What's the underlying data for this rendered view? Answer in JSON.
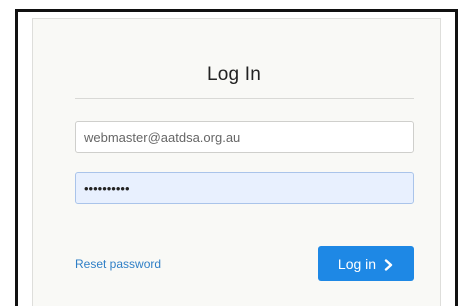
{
  "login_form": {
    "title": "Log In",
    "email_value": "webmaster@aatdsa.org.au",
    "password_value": "••••••••••",
    "reset_password_label": "Reset password",
    "login_button_label": "Log in"
  },
  "colors": {
    "accent": "#1e88e5",
    "link": "#2f7fc6",
    "autofill_background": "#e8f0fe"
  },
  "icons": {
    "login_button_icon": "chevron-right-icon"
  }
}
